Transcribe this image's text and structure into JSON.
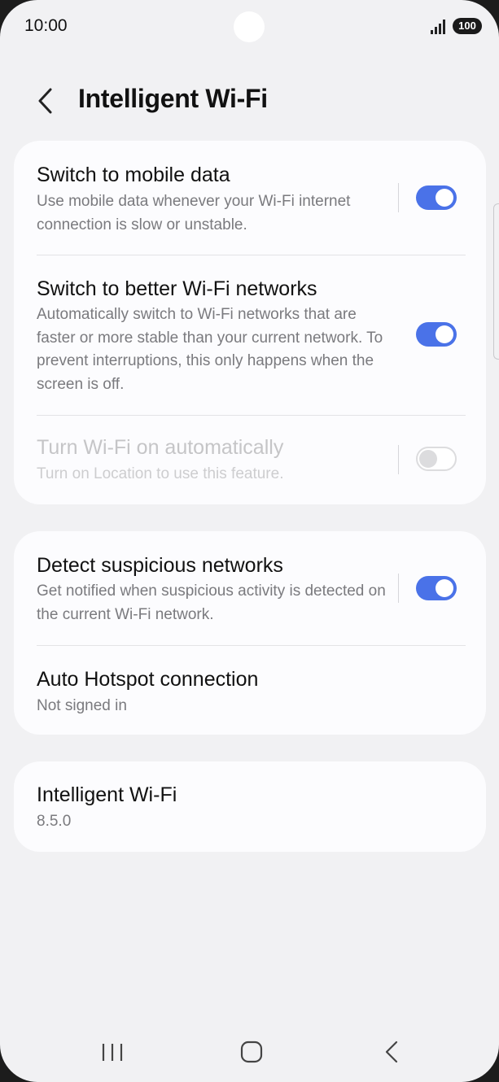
{
  "status_bar": {
    "time": "10:00",
    "battery": "100",
    "signal_icon": "signal-bars-icon"
  },
  "header": {
    "title": "Intelligent Wi-Fi",
    "back_icon": "chevron-left-icon"
  },
  "section1": {
    "items": [
      {
        "title": "Switch to mobile data",
        "subtitle": "Use mobile data whenever your Wi-Fi internet connection is slow or unstable.",
        "toggle": true,
        "enabled": true
      },
      {
        "title": "Switch to better Wi-Fi networks",
        "subtitle": "Automatically switch to Wi-Fi networks that are faster or more stable than your current network. To prevent interruptions, this only happens when the screen is off.",
        "toggle": true,
        "enabled": true
      },
      {
        "title": "Turn Wi-Fi on automatically",
        "subtitle": "Turn on Location to use this feature.",
        "toggle": false,
        "enabled": false
      }
    ]
  },
  "section2": {
    "items": [
      {
        "title": "Detect suspicious networks",
        "subtitle": "Get notified when suspicious activity is detected on the current Wi-Fi network.",
        "toggle": true,
        "enabled": true
      },
      {
        "title": "Auto Hotspot connection",
        "subtitle": "Not signed in"
      }
    ]
  },
  "section3": {
    "items": [
      {
        "title": "Intelligent Wi-Fi",
        "subtitle": "8.5.0"
      }
    ]
  },
  "nav_bar": {
    "recents_icon": "recents-icon",
    "home_icon": "home-icon",
    "back_icon": "back-icon"
  },
  "colors": {
    "accent": "#4a72e8",
    "background": "#f1f1f3",
    "card": "#fcfcfe"
  }
}
